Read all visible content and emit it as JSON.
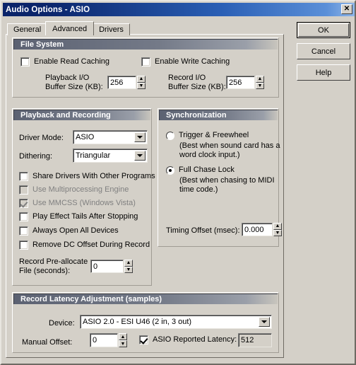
{
  "window": {
    "title": "Audio Options - ASIO",
    "close_label": "✕"
  },
  "tabs": [
    {
      "label": "General",
      "active": false
    },
    {
      "label": "Advanced",
      "active": true
    },
    {
      "label": "Drivers",
      "active": false
    }
  ],
  "buttons": {
    "ok": "OK",
    "cancel": "Cancel",
    "help": "Help"
  },
  "file_system": {
    "title": "File System",
    "enable_read_caching": {
      "label": "Enable Read Caching",
      "checked": false
    },
    "enable_write_caching": {
      "label": "Enable Write Caching",
      "checked": false
    },
    "playback_buffer": {
      "label_line1": "Playback I/O",
      "label_line2": "Buffer Size (KB):",
      "value": "256"
    },
    "record_buffer": {
      "label_line1": "Record I/O",
      "label_line2": "Buffer Size (KB):",
      "value": "256"
    }
  },
  "playback_recording": {
    "title": "Playback and Recording",
    "driver_mode": {
      "label": "Driver Mode:",
      "value": "ASIO"
    },
    "dithering": {
      "label": "Dithering:",
      "value": "Triangular"
    },
    "checkboxes": [
      {
        "label": "Share Drivers With Other Programs",
        "checked": false,
        "disabled": false
      },
      {
        "label": "Use Multiprocessing Engine",
        "checked": false,
        "disabled": true
      },
      {
        "label": "Use MMCSS (Windows Vista)",
        "checked": true,
        "disabled": true
      },
      {
        "label": "Play Effect Tails After Stopping",
        "checked": false,
        "disabled": false
      },
      {
        "label": "Always Open All Devices",
        "checked": false,
        "disabled": false
      },
      {
        "label": "Remove DC Offset During Record",
        "checked": false,
        "disabled": false
      }
    ],
    "prealloc": {
      "label_line1": "Record Pre-allocate",
      "label_line2": "File (seconds):",
      "value": "0"
    }
  },
  "synchronization": {
    "title": "Synchronization",
    "options": [
      {
        "label": "Trigger & Freewheel",
        "hint_line1": "(Best when sound card has a",
        "hint_line2": "word clock input.)",
        "selected": false
      },
      {
        "label": "Full Chase Lock",
        "hint_line1": "(Best when chasing to MIDI",
        "hint_line2": "time code.)",
        "selected": true
      }
    ],
    "timing_offset": {
      "label": "Timing Offset (msec):",
      "value": "0.000"
    }
  },
  "record_latency": {
    "title": "Record Latency Adjustment (samples)",
    "device": {
      "label": "Device:",
      "value": "ASIO 2.0 - ESI U46 (2 in, 3 out)"
    },
    "manual_offset": {
      "label": "Manual Offset:",
      "value": "0"
    },
    "asio_reported_latency": {
      "label": "ASIO Reported Latency:",
      "checked": true,
      "value": "512"
    }
  },
  "icons": {
    "spin_up": "▲",
    "spin_down": "▼"
  }
}
